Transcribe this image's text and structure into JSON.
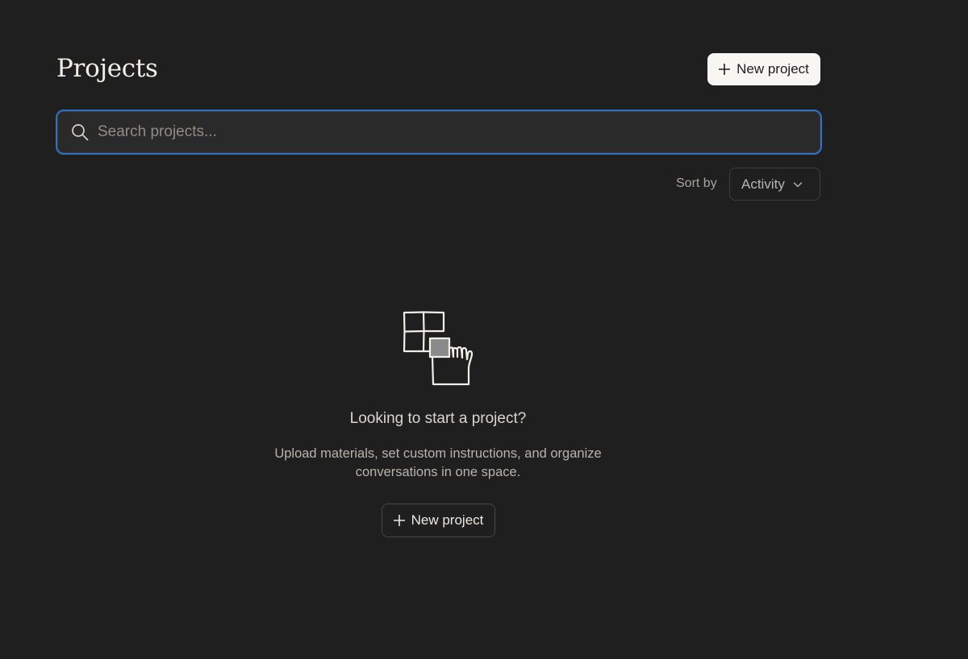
{
  "header": {
    "title": "Projects",
    "new_project_label": "New project"
  },
  "search": {
    "placeholder": "Search projects...",
    "value": ""
  },
  "sort": {
    "label": "Sort by",
    "selected": "Activity"
  },
  "empty_state": {
    "heading": "Looking to start a project?",
    "description": "Upload materials, set custom instructions, and organize conversations in one space.",
    "button_label": "New project"
  },
  "icons": {
    "plus": "plus-icon",
    "search": "search-icon",
    "chevron": "chevron-down-icon",
    "illustration": "hand-grid-illustration-icon"
  },
  "colors": {
    "background": "#1f1f1f",
    "focus_ring": "#2f71c4",
    "primary_button_bg": "#f7f6f2"
  }
}
